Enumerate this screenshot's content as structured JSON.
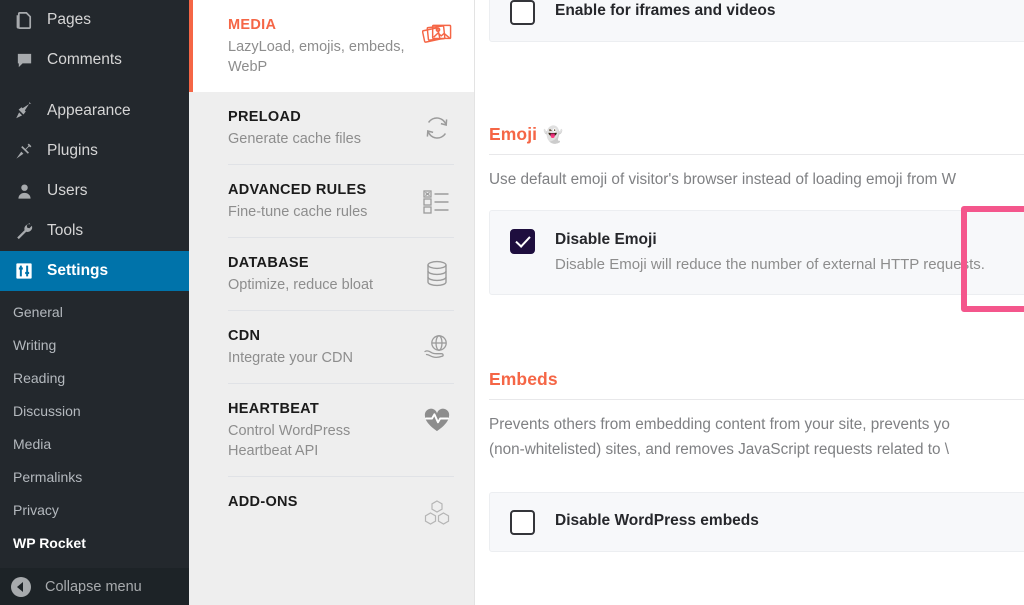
{
  "wp_sidebar": {
    "items": [
      {
        "label": "Pages",
        "icon": "pages-icon",
        "active": false
      },
      {
        "label": "Comments",
        "icon": "comments-icon",
        "active": false
      },
      {
        "label": "Appearance",
        "icon": "appearance-brush-icon",
        "active": false
      },
      {
        "label": "Plugins",
        "icon": "plugins-plug-icon",
        "active": false
      },
      {
        "label": "Users",
        "icon": "users-person-icon",
        "active": false
      },
      {
        "label": "Tools",
        "icon": "tools-wrench-icon",
        "active": false
      },
      {
        "label": "Settings",
        "icon": "settings-sliders-icon",
        "active": true
      }
    ],
    "submenu": [
      {
        "label": "General",
        "current": false
      },
      {
        "label": "Writing",
        "current": false
      },
      {
        "label": "Reading",
        "current": false
      },
      {
        "label": "Discussion",
        "current": false
      },
      {
        "label": "Media",
        "current": false
      },
      {
        "label": "Permalinks",
        "current": false
      },
      {
        "label": "Privacy",
        "current": false
      },
      {
        "label": "WP Rocket",
        "current": true
      }
    ],
    "collapse_label": "Collapse menu",
    "collapse_icon": "chevron-left-circle-icon",
    "active_color": "#0073aa",
    "background": "#23282d"
  },
  "rocket_nav": {
    "accent_color": "#f56646",
    "items": [
      {
        "title": "MEDIA",
        "desc": "LazyLoad, emojis, embeds, WebP",
        "icon": "photos-stack-icon",
        "active": true
      },
      {
        "title": "PRELOAD",
        "desc": "Generate cache files",
        "icon": "refresh-circular-arrows-icon",
        "active": false
      },
      {
        "title": "ADVANCED RULES",
        "desc": "Fine-tune cache rules",
        "icon": "checklist-icon",
        "active": false
      },
      {
        "title": "DATABASE",
        "desc": "Optimize, reduce bloat",
        "icon": "database-stack-icon",
        "active": false
      },
      {
        "title": "CDN",
        "desc": "Integrate your CDN",
        "icon": "globe-hand-icon",
        "active": false
      },
      {
        "title": "HEARTBEAT",
        "desc": "Control WordPress Heartbeat API",
        "icon": "heart-pulse-icon",
        "active": false
      },
      {
        "title": "ADD-ONS",
        "desc": "",
        "icon": "cubes-icon",
        "active": false
      }
    ]
  },
  "main": {
    "iframes_option": {
      "label": "Enable for iframes and videos",
      "checked": false
    },
    "emoji_section": {
      "heading": "Emoji",
      "heading_emoji": "👻",
      "description": "Use default emoji of visitor's browser instead of loading emoji from W",
      "option_label": "Disable Emoji",
      "option_desc": "Disable Emoji will reduce the number of external HTTP requests.",
      "checked": true,
      "highlight_color": "#f4568c"
    },
    "embeds_section": {
      "heading": "Embeds",
      "description_line1": "Prevents others from embedding content from your site, prevents yo",
      "description_line2": "(non-whitelisted) sites, and removes JavaScript requests related to \\",
      "option_label": "Disable WordPress embeds",
      "checked": false
    }
  }
}
